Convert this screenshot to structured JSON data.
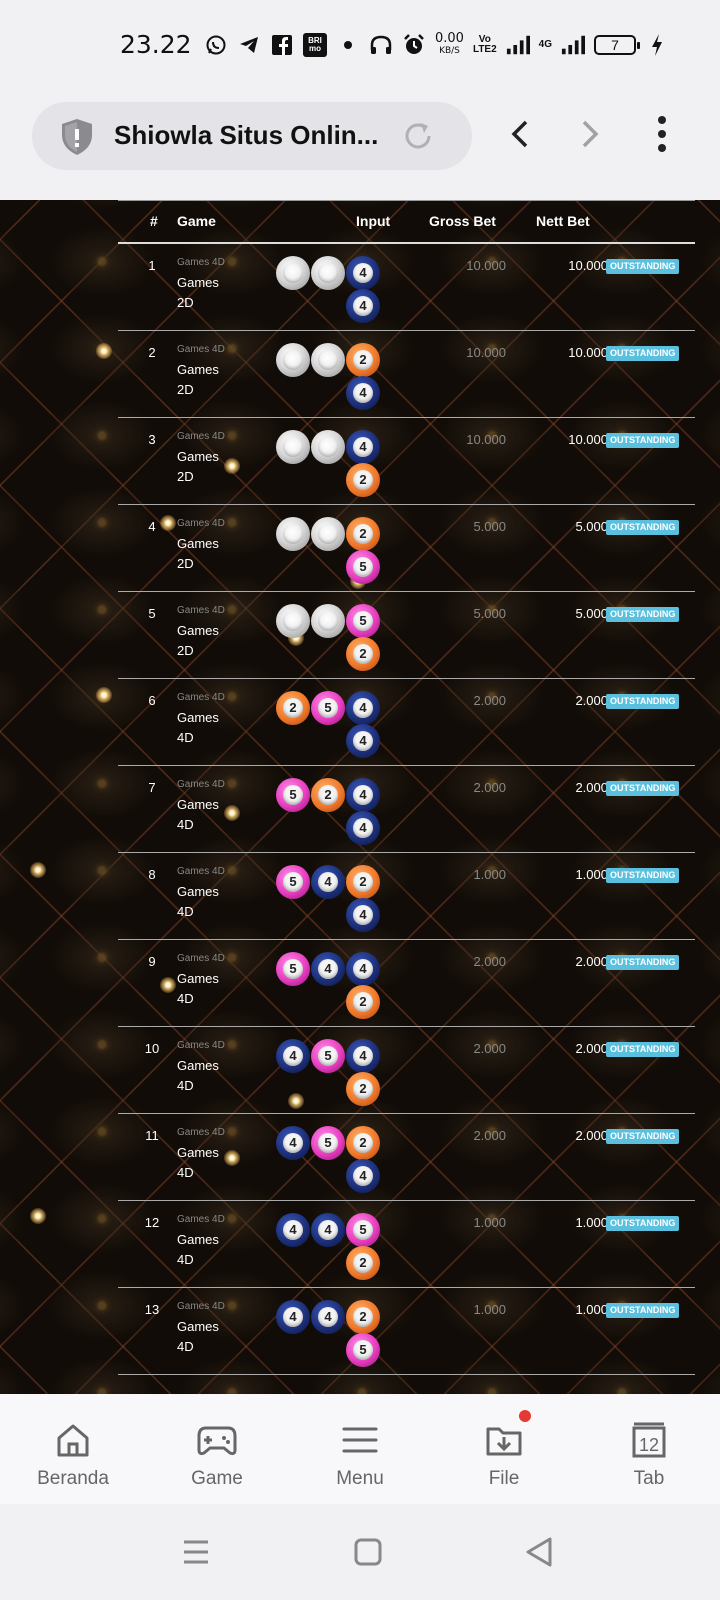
{
  "status_bar": {
    "time": "23.22",
    "speed_value": "0.00",
    "speed_unit": "KB/S",
    "volte": "Vo",
    "lte": "LTE2",
    "network": "4G",
    "battery": "7",
    "icons": [
      "whatsapp-icon",
      "telegram-icon",
      "facebook-icon",
      "brimo-icon",
      "dot-icon",
      "headphones-icon",
      "alarm-icon",
      "signal-icon",
      "battery-icon",
      "charging-icon"
    ]
  },
  "browser": {
    "title": "Shiowla Situs Onlin...",
    "icons": [
      "shield-icon",
      "reload-icon",
      "back-icon",
      "forward-icon",
      "more-icon"
    ]
  },
  "table": {
    "headers": {
      "no": "#",
      "game": "Game",
      "input": "Input",
      "gross": "Gross Bet",
      "nett": "Nett Bet"
    },
    "rows": [
      {
        "no": "1",
        "game_type": "Games 4D",
        "game_line1": "Games",
        "game_line2": "2D",
        "balls": [
          [
            "white",
            ""
          ],
          [
            "white",
            ""
          ],
          [
            "blue",
            "4"
          ],
          [
            "blue",
            "4"
          ]
        ],
        "gross": "10.000",
        "nett": "10.000",
        "status": "OUTSTANDING"
      },
      {
        "no": "2",
        "game_type": "Games 4D",
        "game_line1": "Games",
        "game_line2": "2D",
        "balls": [
          [
            "white",
            ""
          ],
          [
            "white",
            ""
          ],
          [
            "orange",
            "2"
          ],
          [
            "blue",
            "4"
          ]
        ],
        "gross": "10.000",
        "nett": "10.000",
        "status": "OUTSTANDING"
      },
      {
        "no": "3",
        "game_type": "Games 4D",
        "game_line1": "Games",
        "game_line2": "2D",
        "balls": [
          [
            "white",
            ""
          ],
          [
            "white",
            ""
          ],
          [
            "blue",
            "4"
          ],
          [
            "orange",
            "2"
          ]
        ],
        "gross": "10.000",
        "nett": "10.000",
        "status": "OUTSTANDING"
      },
      {
        "no": "4",
        "game_type": "Games 4D",
        "game_line1": "Games",
        "game_line2": "2D",
        "balls": [
          [
            "white",
            ""
          ],
          [
            "white",
            ""
          ],
          [
            "orange",
            "2"
          ],
          [
            "pink",
            "5"
          ]
        ],
        "gross": "5.000",
        "nett": "5.000",
        "status": "OUTSTANDING"
      },
      {
        "no": "5",
        "game_type": "Games 4D",
        "game_line1": "Games",
        "game_line2": "2D",
        "balls": [
          [
            "white",
            ""
          ],
          [
            "white",
            ""
          ],
          [
            "pink",
            "5"
          ],
          [
            "orange",
            "2"
          ]
        ],
        "gross": "5.000",
        "nett": "5.000",
        "status": "OUTSTANDING"
      },
      {
        "no": "6",
        "game_type": "Games 4D",
        "game_line1": "Games",
        "game_line2": "4D",
        "balls": [
          [
            "orange",
            "2"
          ],
          [
            "pink",
            "5"
          ],
          [
            "blue",
            "4"
          ],
          [
            "blue",
            "4"
          ]
        ],
        "gross": "2.000",
        "nett": "2.000",
        "status": "OUTSTANDING"
      },
      {
        "no": "7",
        "game_type": "Games 4D",
        "game_line1": "Games",
        "game_line2": "4D",
        "balls": [
          [
            "pink",
            "5"
          ],
          [
            "orange",
            "2"
          ],
          [
            "blue",
            "4"
          ],
          [
            "blue",
            "4"
          ]
        ],
        "gross": "2.000",
        "nett": "2.000",
        "status": "OUTSTANDING"
      },
      {
        "no": "8",
        "game_type": "Games 4D",
        "game_line1": "Games",
        "game_line2": "4D",
        "balls": [
          [
            "pink",
            "5"
          ],
          [
            "blue",
            "4"
          ],
          [
            "orange",
            "2"
          ],
          [
            "blue",
            "4"
          ]
        ],
        "gross": "1.000",
        "nett": "1.000",
        "status": "OUTSTANDING"
      },
      {
        "no": "9",
        "game_type": "Games 4D",
        "game_line1": "Games",
        "game_line2": "4D",
        "balls": [
          [
            "pink",
            "5"
          ],
          [
            "blue",
            "4"
          ],
          [
            "blue",
            "4"
          ],
          [
            "orange",
            "2"
          ]
        ],
        "gross": "2.000",
        "nett": "2.000",
        "status": "OUTSTANDING"
      },
      {
        "no": "10",
        "game_type": "Games 4D",
        "game_line1": "Games",
        "game_line2": "4D",
        "balls": [
          [
            "blue",
            "4"
          ],
          [
            "pink",
            "5"
          ],
          [
            "blue",
            "4"
          ],
          [
            "orange",
            "2"
          ]
        ],
        "gross": "2.000",
        "nett": "2.000",
        "status": "OUTSTANDING"
      },
      {
        "no": "11",
        "game_type": "Games 4D",
        "game_line1": "Games",
        "game_line2": "4D",
        "balls": [
          [
            "blue",
            "4"
          ],
          [
            "pink",
            "5"
          ],
          [
            "orange",
            "2"
          ],
          [
            "blue",
            "4"
          ]
        ],
        "gross": "2.000",
        "nett": "2.000",
        "status": "OUTSTANDING"
      },
      {
        "no": "12",
        "game_type": "Games 4D",
        "game_line1": "Games",
        "game_line2": "4D",
        "balls": [
          [
            "blue",
            "4"
          ],
          [
            "blue",
            "4"
          ],
          [
            "pink",
            "5"
          ],
          [
            "orange",
            "2"
          ]
        ],
        "gross": "1.000",
        "nett": "1.000",
        "status": "OUTSTANDING"
      },
      {
        "no": "13",
        "game_type": "Games 4D",
        "game_line1": "Games",
        "game_line2": "4D",
        "balls": [
          [
            "blue",
            "4"
          ],
          [
            "blue",
            "4"
          ],
          [
            "orange",
            "2"
          ],
          [
            "pink",
            "5"
          ]
        ],
        "gross": "1.000",
        "nett": "1.000",
        "status": "OUTSTANDING"
      }
    ]
  },
  "bottom_nav": {
    "items": [
      {
        "label": "Beranda",
        "icon": "home-icon"
      },
      {
        "label": "Game",
        "icon": "gamepad-icon"
      },
      {
        "label": "Menu",
        "icon": "menu-icon"
      },
      {
        "label": "File",
        "icon": "file-download-icon"
      },
      {
        "label": "Tab",
        "icon": "tabs-icon",
        "count": "12"
      }
    ]
  },
  "system_nav": {
    "icons": [
      "recents-icon",
      "home-square-icon",
      "back-triangle-icon"
    ]
  },
  "colors": {
    "status_badge": "#5bc0de",
    "accent_dot": "#e53935"
  }
}
